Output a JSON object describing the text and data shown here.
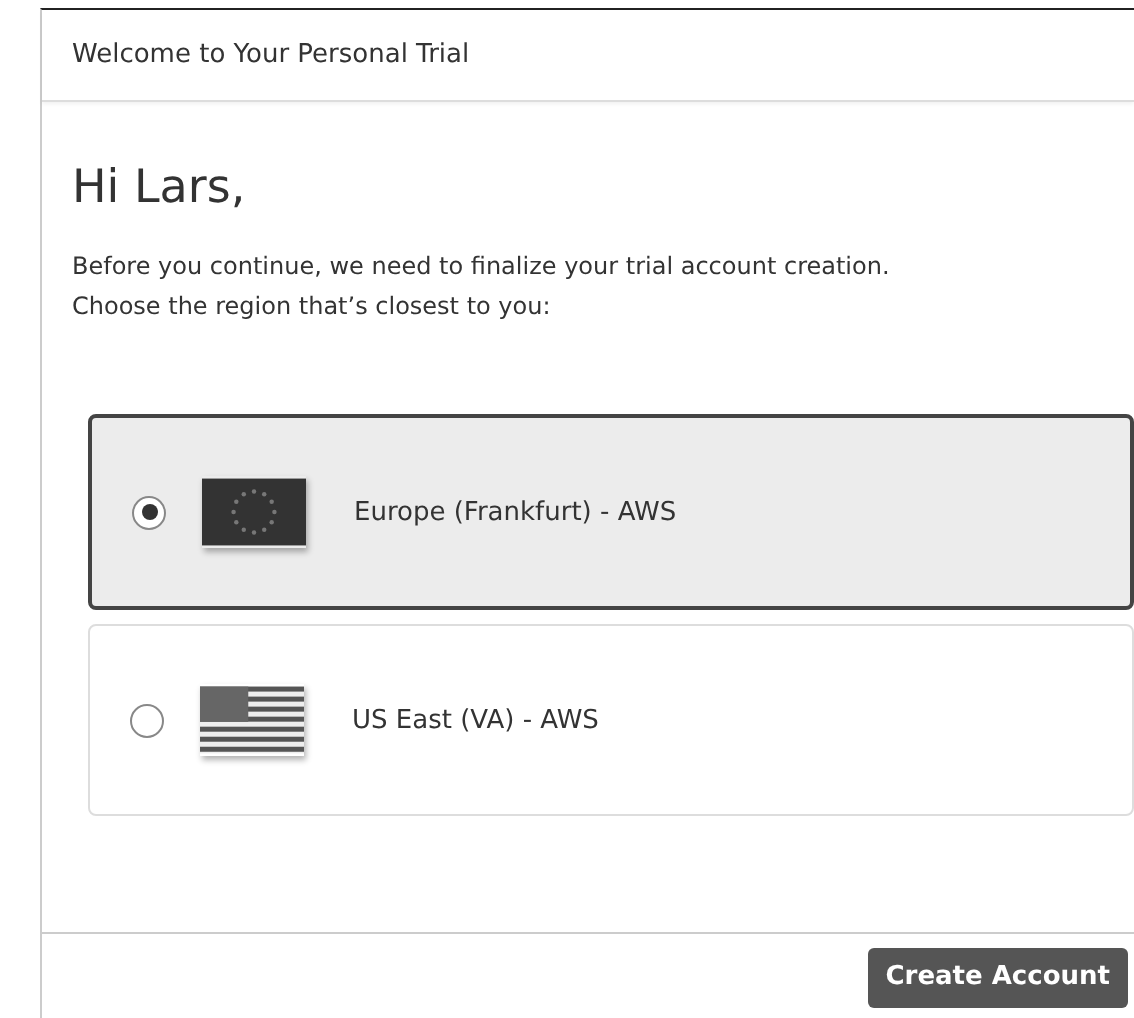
{
  "dialog": {
    "title": "Welcome to Your Personal Trial"
  },
  "greeting": "Hi Lars,",
  "intro": [
    "Before you continue, we need to finalize your trial account creation.",
    "Choose the region that’s closest to you:"
  ],
  "regions": [
    {
      "label": "Europe (Frankfurt) - AWS",
      "kind": "eu",
      "selected": true
    },
    {
      "label": "US East (VA) - AWS",
      "kind": "us",
      "selected": false
    }
  ],
  "buttons": [
    "Create Account"
  ]
}
